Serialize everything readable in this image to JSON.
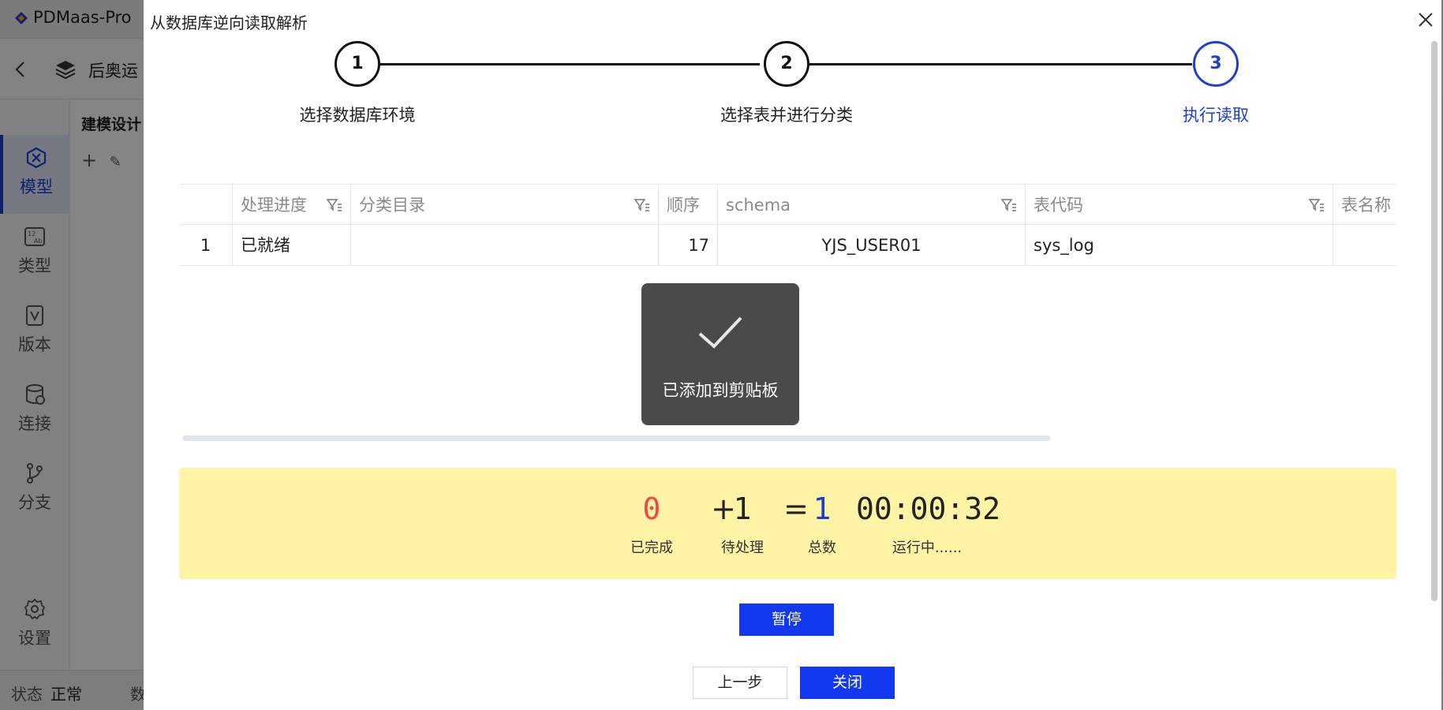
{
  "app": {
    "name": "PDMaas-Pro",
    "project_name": "后奥运",
    "panel_title": "建模设计",
    "sidebar": [
      {
        "label": "模型",
        "icon": "model-icon",
        "active": true
      },
      {
        "label": "类型",
        "icon": "type-icon",
        "active": false
      },
      {
        "label": "版本",
        "icon": "version-icon",
        "active": false
      },
      {
        "label": "连接",
        "icon": "connection-icon",
        "active": false
      },
      {
        "label": "分支",
        "icon": "branch-icon",
        "active": false
      },
      {
        "label": "设置",
        "icon": "settings-icon",
        "active": false
      }
    ],
    "status": {
      "label": "状态",
      "value": "正常",
      "more": "数"
    }
  },
  "modal": {
    "title": "从数据库逆向读取解析",
    "steps": [
      {
        "number": "1",
        "label": "选择数据库环境",
        "active": false
      },
      {
        "number": "2",
        "label": "选择表并进行分类",
        "active": false
      },
      {
        "number": "3",
        "label": "执行读取",
        "active": true
      }
    ],
    "table": {
      "columns": [
        "",
        "处理进度",
        "分类目录",
        "顺序",
        "schema",
        "表代码",
        "表名称"
      ],
      "rows": [
        [
          "1",
          "已就绪",
          "",
          "17",
          "YJS_USER01",
          "sys_log",
          ""
        ]
      ]
    },
    "toast": {
      "text": "已添加到剪贴板"
    },
    "summary": {
      "completed": "0",
      "plus": "+",
      "pending": "1",
      "equals": "=",
      "total": "1",
      "elapsed": "00:00:32",
      "completed_label": "已完成",
      "pending_label": "待处理",
      "total_label": "总数",
      "state_label": "运行中......"
    },
    "buttons": {
      "pause": "暂停",
      "prev": "上一步",
      "close": "关闭"
    },
    "colors": {
      "accent": "#1339f0",
      "completed": "#f04848",
      "total": "#1f3fd1",
      "summary_bg": "#fff3a6"
    }
  }
}
